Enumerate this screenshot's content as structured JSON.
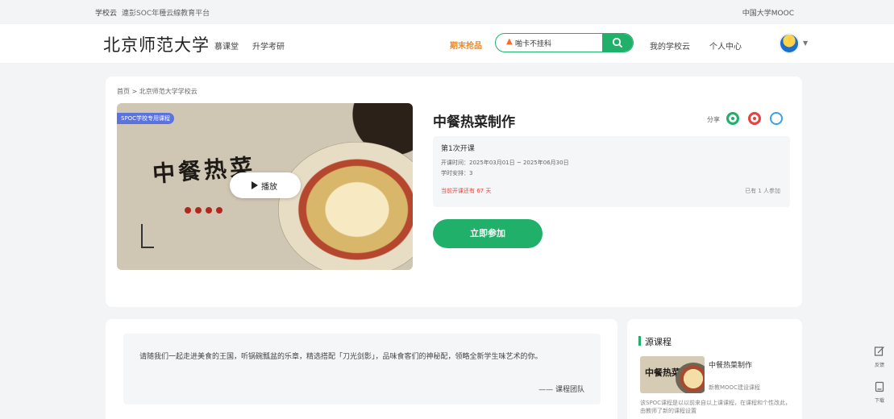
{
  "topbar": {
    "brand": "学校云",
    "tagline": "連彭SOC年種云線教育平台",
    "mooc_link": "中国大学MOOC"
  },
  "header": {
    "logo": "北京师范大学",
    "nav": [
      "慕课堂",
      "升学考研"
    ],
    "hot_label": "期末抢品",
    "search_value": "啪卡不挂科",
    "right_links": [
      "我的学校云",
      "个人中心"
    ]
  },
  "course": {
    "breadcrumb": "首页 > 北京师范大学学校云",
    "badge": "SPOC学校专用课程",
    "cover_calligraphy": "中餐热菜",
    "play_label": "播放",
    "title": "中餐热菜制作",
    "share_label": "分享",
    "term": "第1次开课",
    "dates": "开课时间：2025年03月01日 ~ 2025年06月30日",
    "hours": "学时安排：3",
    "price_note": "当前开课还有 67 天",
    "joined": "已有 1 人参加",
    "join_button": "立即参加"
  },
  "intro": {
    "quote": "请随我们一起走进美食的王国，听锅碗瓢盆的乐章，精选搭配「刀光剑影」，品味食客们的神秘配，领略全新学生味艺术的你。",
    "signature": "—— 课程团队"
  },
  "sidebar": {
    "heading": "源课程",
    "course_title": "中餐热菜制作",
    "provider": "新教MOOC建设课程",
    "description": "该SPOC课程是以以前来自以上课课程，在课程和个性改此，由教师了新的课程设置"
  },
  "tools": [
    {
      "icon": "feedback-icon",
      "label": "反馈"
    },
    {
      "icon": "download-icon",
      "label": "下载"
    }
  ],
  "colors": {
    "accent": "#20b069",
    "hot": "#e8882c",
    "price": "#e04a3c",
    "badge": "#5a73e0"
  }
}
